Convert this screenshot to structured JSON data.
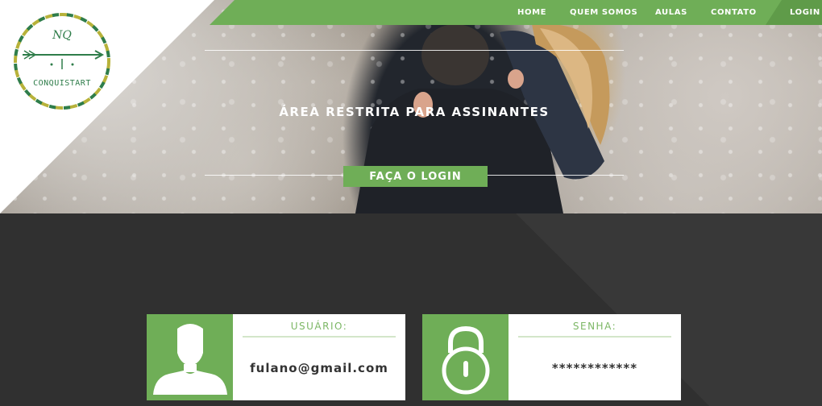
{
  "brand": {
    "logo_monogram": "NQ",
    "logo_text": "CONQUISTART",
    "colors": {
      "green": "#6fae57",
      "dark": "#333333",
      "logo_green": "#2f7d4a",
      "logo_olive": "#b7b23a"
    }
  },
  "nav": {
    "items": [
      {
        "label": "HOME"
      },
      {
        "label": "QUEM SOMOS"
      },
      {
        "label": "AULAS"
      },
      {
        "label": "CONTATO"
      },
      {
        "label": "LOGIN"
      }
    ]
  },
  "hero": {
    "title": "ÁREA RESTRITA PARA ASSINANTES",
    "cta_label": "FAÇA O LOGIN"
  },
  "login_form": {
    "user": {
      "label": "USUÁRIO:",
      "value": "fulano@gmail.com",
      "icon": "user-silhouette-icon"
    },
    "password": {
      "label": "SENHA:",
      "value": "************",
      "icon": "padlock-icon"
    }
  }
}
